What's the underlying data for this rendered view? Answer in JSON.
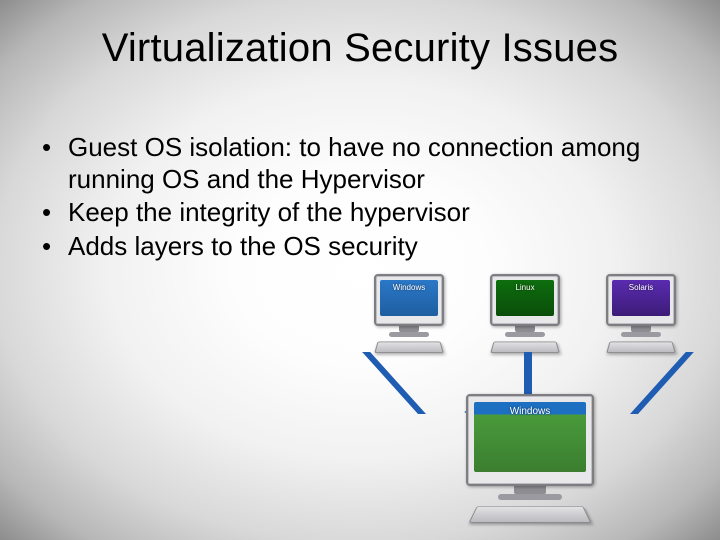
{
  "title": "Virtualization Security Issues",
  "bullets": [
    "Guest OS isolation: to have no connection among running OS and the Hypervisor",
    "Keep the integrity of the hypervisor",
    "Adds layers to the OS security"
  ],
  "diagram": {
    "guests": [
      "Windows",
      "Linux",
      "Solaris"
    ],
    "host": "Windows"
  }
}
